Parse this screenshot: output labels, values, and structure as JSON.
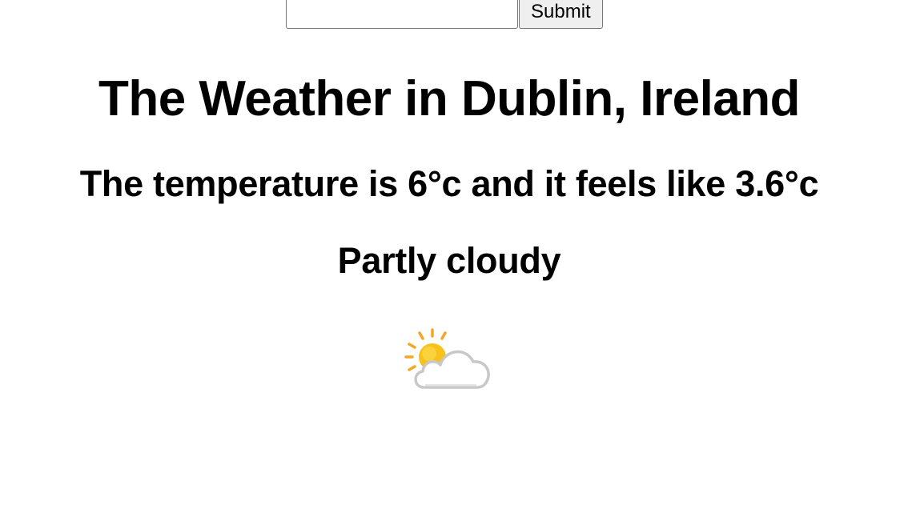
{
  "search": {
    "value": "",
    "placeholder": "",
    "submit_label": "Submit"
  },
  "weather": {
    "title": "The Weather in Dublin, Ireland",
    "temperature_line": "The temperature is 6°c and it feels like 3.6°c",
    "condition": "Partly cloudy",
    "icon": "partly-cloudy-icon"
  },
  "colors": {
    "sun": "#f7c21b",
    "sun_rays": "#f5a623",
    "cloud_fill": "#ffffff",
    "cloud_outline": "#c8c8c8"
  }
}
